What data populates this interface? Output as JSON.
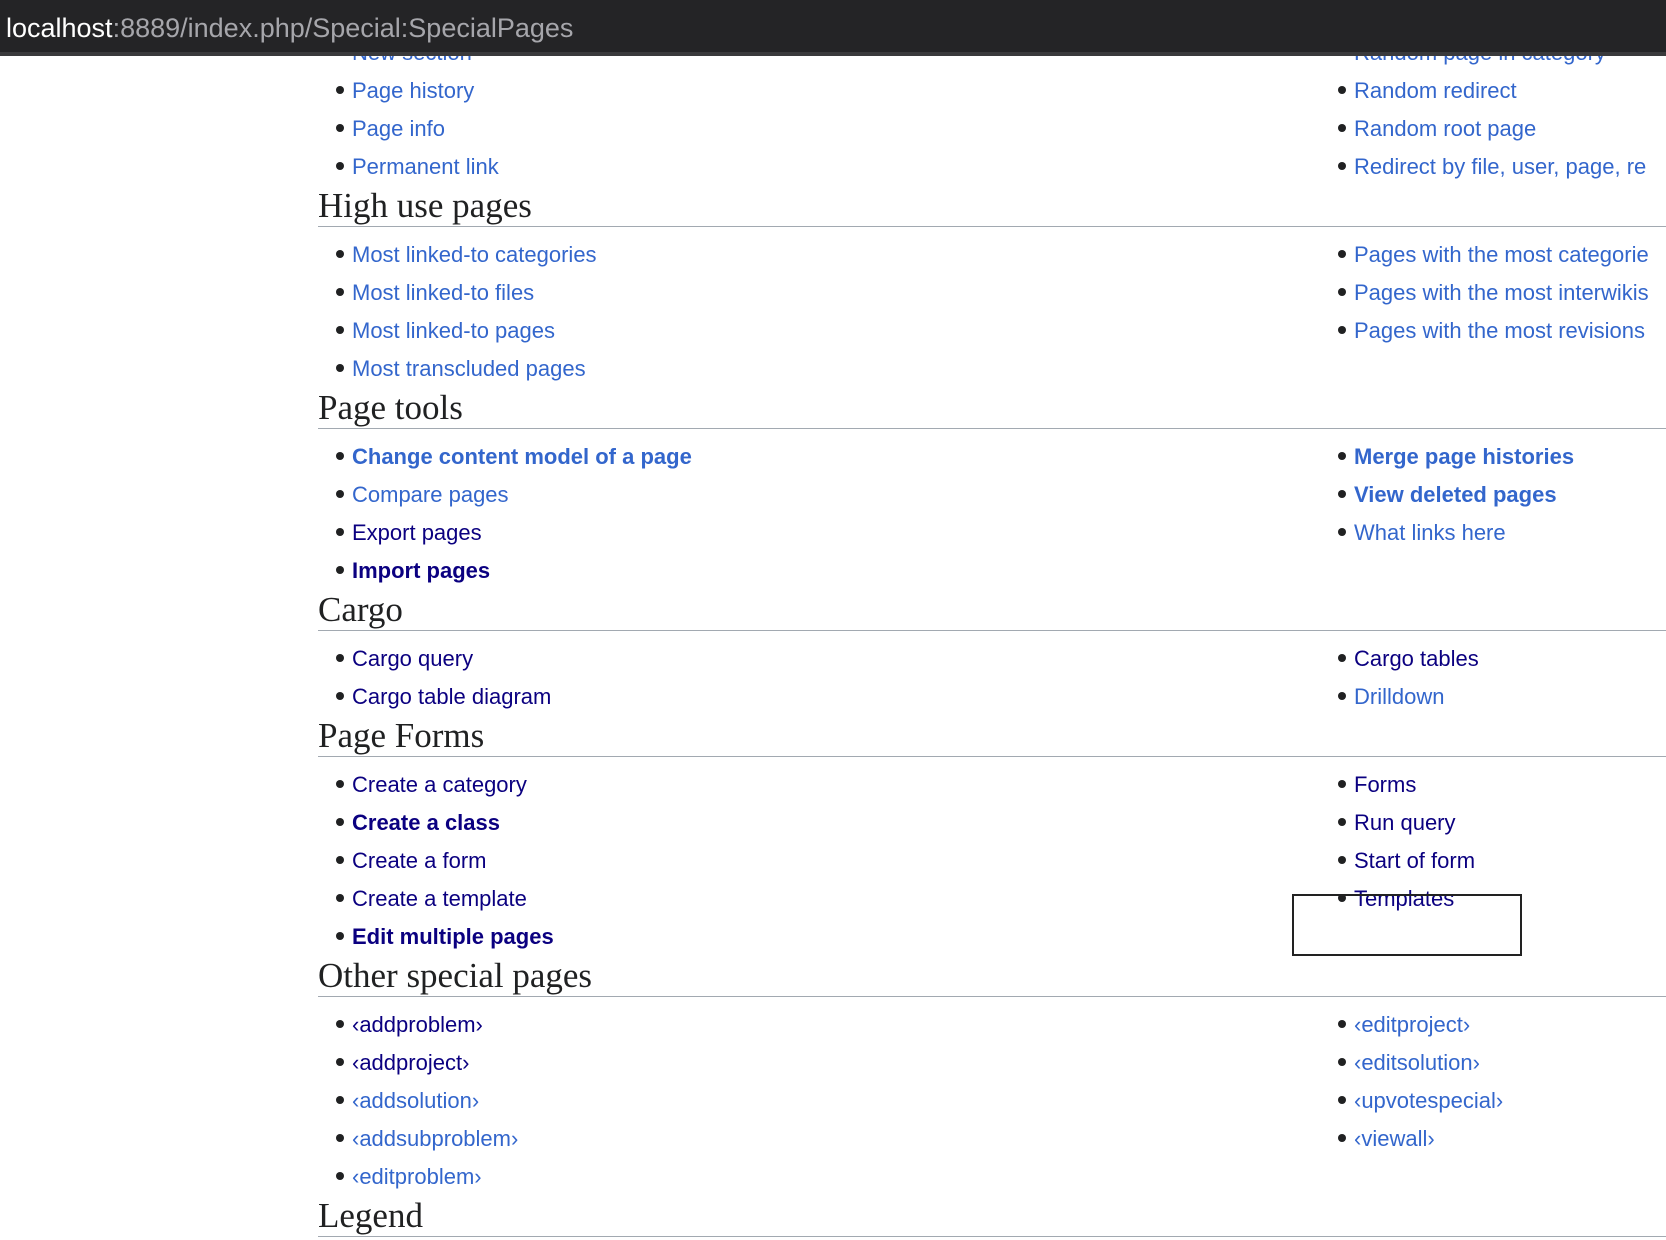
{
  "browser": {
    "url_host": "localhost",
    "url_path": ":8889/index.php/Special:SpecialPages"
  },
  "colors": {
    "link": "#3366cc",
    "link_visited": "#0b0080",
    "heading_rule": "#a2a9b1"
  },
  "sections": [
    {
      "key": "top",
      "heading": "",
      "left": [
        {
          "label": "New section",
          "state": "new"
        },
        {
          "label": "Page history",
          "state": "new"
        },
        {
          "label": "Page info",
          "state": "new"
        },
        {
          "label": "Permanent link",
          "state": "new"
        }
      ],
      "right": [
        {
          "label": "Random page in category",
          "state": "new"
        },
        {
          "label": "Random redirect",
          "state": "new"
        },
        {
          "label": "Random root page",
          "state": "new"
        },
        {
          "label": "Redirect by file, user, page, re",
          "state": "new"
        }
      ]
    },
    {
      "key": "high-use-pages",
      "heading": "High use pages",
      "left": [
        {
          "label": "Most linked-to categories",
          "state": "new"
        },
        {
          "label": "Most linked-to files",
          "state": "new"
        },
        {
          "label": "Most linked-to pages",
          "state": "new"
        },
        {
          "label": "Most transcluded pages",
          "state": "new"
        }
      ],
      "right": [
        {
          "label": "Pages with the most categorie",
          "state": "new"
        },
        {
          "label": "Pages with the most interwikis",
          "state": "new"
        },
        {
          "label": "Pages with the most revisions",
          "state": "new"
        }
      ]
    },
    {
      "key": "page-tools",
      "heading": "Page tools",
      "left": [
        {
          "label": "Change content model of a page",
          "state": "new",
          "bold": true
        },
        {
          "label": "Compare pages",
          "state": "new"
        },
        {
          "label": "Export pages",
          "state": "visited"
        },
        {
          "label": "Import pages",
          "state": "visited",
          "bold": true
        }
      ],
      "right": [
        {
          "label": "Merge page histories",
          "state": "new",
          "bold": true
        },
        {
          "label": "View deleted pages",
          "state": "new",
          "bold": true
        },
        {
          "label": "What links here",
          "state": "new"
        }
      ]
    },
    {
      "key": "cargo",
      "heading": "Cargo",
      "left": [
        {
          "label": "Cargo query",
          "state": "visited"
        },
        {
          "label": "Cargo table diagram",
          "state": "visited"
        }
      ],
      "right": [
        {
          "label": "Cargo tables",
          "state": "visited"
        },
        {
          "label": "Drilldown",
          "state": "new"
        }
      ]
    },
    {
      "key": "page-forms",
      "heading": "Page Forms",
      "left": [
        {
          "label": "Create a category",
          "state": "visited"
        },
        {
          "label": "Create a class",
          "state": "visited",
          "bold": true
        },
        {
          "label": "Create a form",
          "state": "visited"
        },
        {
          "label": "Create a template",
          "state": "visited"
        },
        {
          "label": "Edit multiple pages",
          "state": "visited",
          "bold": true
        }
      ],
      "right": [
        {
          "label": "Forms",
          "state": "visited"
        },
        {
          "label": "Run query",
          "state": "visited"
        },
        {
          "label": "Start of form",
          "state": "visited"
        },
        {
          "label": "Templates",
          "state": "visited"
        }
      ]
    },
    {
      "key": "other-special-pages",
      "heading": "Other special pages",
      "left": [
        {
          "label": "‹addproblem›",
          "state": "visited"
        },
        {
          "label": "‹addproject›",
          "state": "visited"
        },
        {
          "label": "‹addsolution›",
          "state": "new"
        },
        {
          "label": "‹addsubproblem›",
          "state": "new"
        },
        {
          "label": "‹editproblem›",
          "state": "new"
        }
      ],
      "right": [
        {
          "label": "‹editproject›",
          "state": "new"
        },
        {
          "label": "‹editsolution›",
          "state": "new"
        },
        {
          "label": "‹upvotespecial›",
          "state": "new"
        },
        {
          "label": "‹viewall›",
          "state": "new"
        }
      ]
    },
    {
      "key": "legend",
      "heading": "Legend",
      "left": [],
      "right": []
    }
  ]
}
